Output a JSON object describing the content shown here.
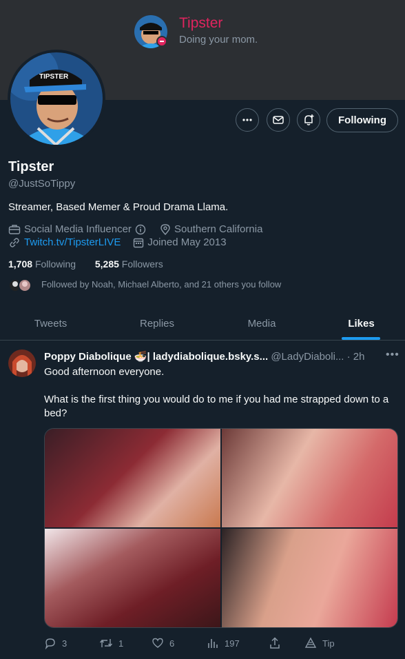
{
  "banner_card": {
    "name": "Tipster",
    "status": "Doing your mom."
  },
  "profile": {
    "display_name": "Tipster",
    "handle": "@JustSoTippy",
    "bio": "Streamer, Based Memer & Proud Drama Llama.",
    "category": "Social Media Influencer",
    "location": "Southern California",
    "link": "Twitch.tv/TipsterLIVE",
    "joined": "Joined May 2013",
    "following_count": "1,708",
    "following_label": "Following",
    "followers_count": "5,285",
    "followers_label": "Followers",
    "followed_by": "Followed by Noah, Michael Alberto, and 21 others you follow",
    "avatar_cap_text": "TIPSTER"
  },
  "buttons": {
    "follow": "Following"
  },
  "tabs": [
    {
      "label": "Tweets"
    },
    {
      "label": "Replies"
    },
    {
      "label": "Media"
    },
    {
      "label": "Likes",
      "active": true
    }
  ],
  "tweet": {
    "author": "Poppy Diabolique 🍜| ladydiabolique.bsky.s...",
    "handle": "@LadyDiaboli...",
    "time": "· 2h",
    "text_line1": "Good afternoon everyone.",
    "text_line2": "What is the first thing you would do to me if you had me strapped down to a bed?",
    "replies": "3",
    "retweets": "1",
    "likes": "6",
    "views": "197",
    "tip": "Tip"
  },
  "colors": {
    "accent": "#1d9bf0",
    "background": "#15202b",
    "banner": "#2c2f33",
    "status_red": "#e0245e"
  }
}
